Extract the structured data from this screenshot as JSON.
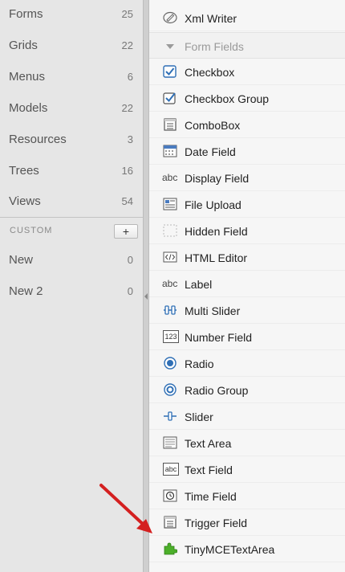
{
  "left_panel": {
    "items": [
      {
        "label": "Forms",
        "count": "25"
      },
      {
        "label": "Grids",
        "count": "22"
      },
      {
        "label": "Menus",
        "count": "6"
      },
      {
        "label": "Models",
        "count": "22"
      },
      {
        "label": "Resources",
        "count": "3"
      },
      {
        "label": "Trees",
        "count": "16"
      },
      {
        "label": "Views",
        "count": "54"
      }
    ],
    "custom_heading": "CUSTOM",
    "add_label": "+",
    "custom_items": [
      {
        "label": "New",
        "count": "0"
      },
      {
        "label": "New 2",
        "count": "0"
      }
    ]
  },
  "right_panel": {
    "top_item": {
      "label": "Xml Writer",
      "icon": "xml-writer-icon"
    },
    "section_title": "Form Fields",
    "items": [
      {
        "label": "Checkbox",
        "icon": "checkbox-icon"
      },
      {
        "label": "Checkbox Group",
        "icon": "checkbox-group-icon"
      },
      {
        "label": "ComboBox",
        "icon": "combobox-icon"
      },
      {
        "label": "Date Field",
        "icon": "calendar-icon"
      },
      {
        "label": "Display Field",
        "icon": "abc-text-icon",
        "icon_text": "abc"
      },
      {
        "label": "File Upload",
        "icon": "file-upload-icon"
      },
      {
        "label": "Hidden Field",
        "icon": "hidden-field-icon"
      },
      {
        "label": "HTML Editor",
        "icon": "html-editor-icon"
      },
      {
        "label": "Label",
        "icon": "abc-text-icon",
        "icon_text": "abc"
      },
      {
        "label": "Multi Slider",
        "icon": "multi-slider-icon"
      },
      {
        "label": "Number Field",
        "icon": "number-field-icon",
        "icon_text": "123"
      },
      {
        "label": "Radio",
        "icon": "radio-icon"
      },
      {
        "label": "Radio Group",
        "icon": "radio-group-icon"
      },
      {
        "label": "Slider",
        "icon": "slider-icon"
      },
      {
        "label": "Text Area",
        "icon": "text-area-icon"
      },
      {
        "label": "Text Field",
        "icon": "text-field-icon",
        "icon_text": "abc"
      },
      {
        "label": "Time Field",
        "icon": "clock-icon"
      },
      {
        "label": "Trigger Field",
        "icon": "trigger-field-icon"
      },
      {
        "label": "TinyMCETextArea",
        "icon": "puzzle-plugin-icon"
      }
    ]
  },
  "colors": {
    "accent_blue": "#2f6fb5",
    "arrow_red": "#d42020",
    "plugin_green": "#4caf2a"
  }
}
